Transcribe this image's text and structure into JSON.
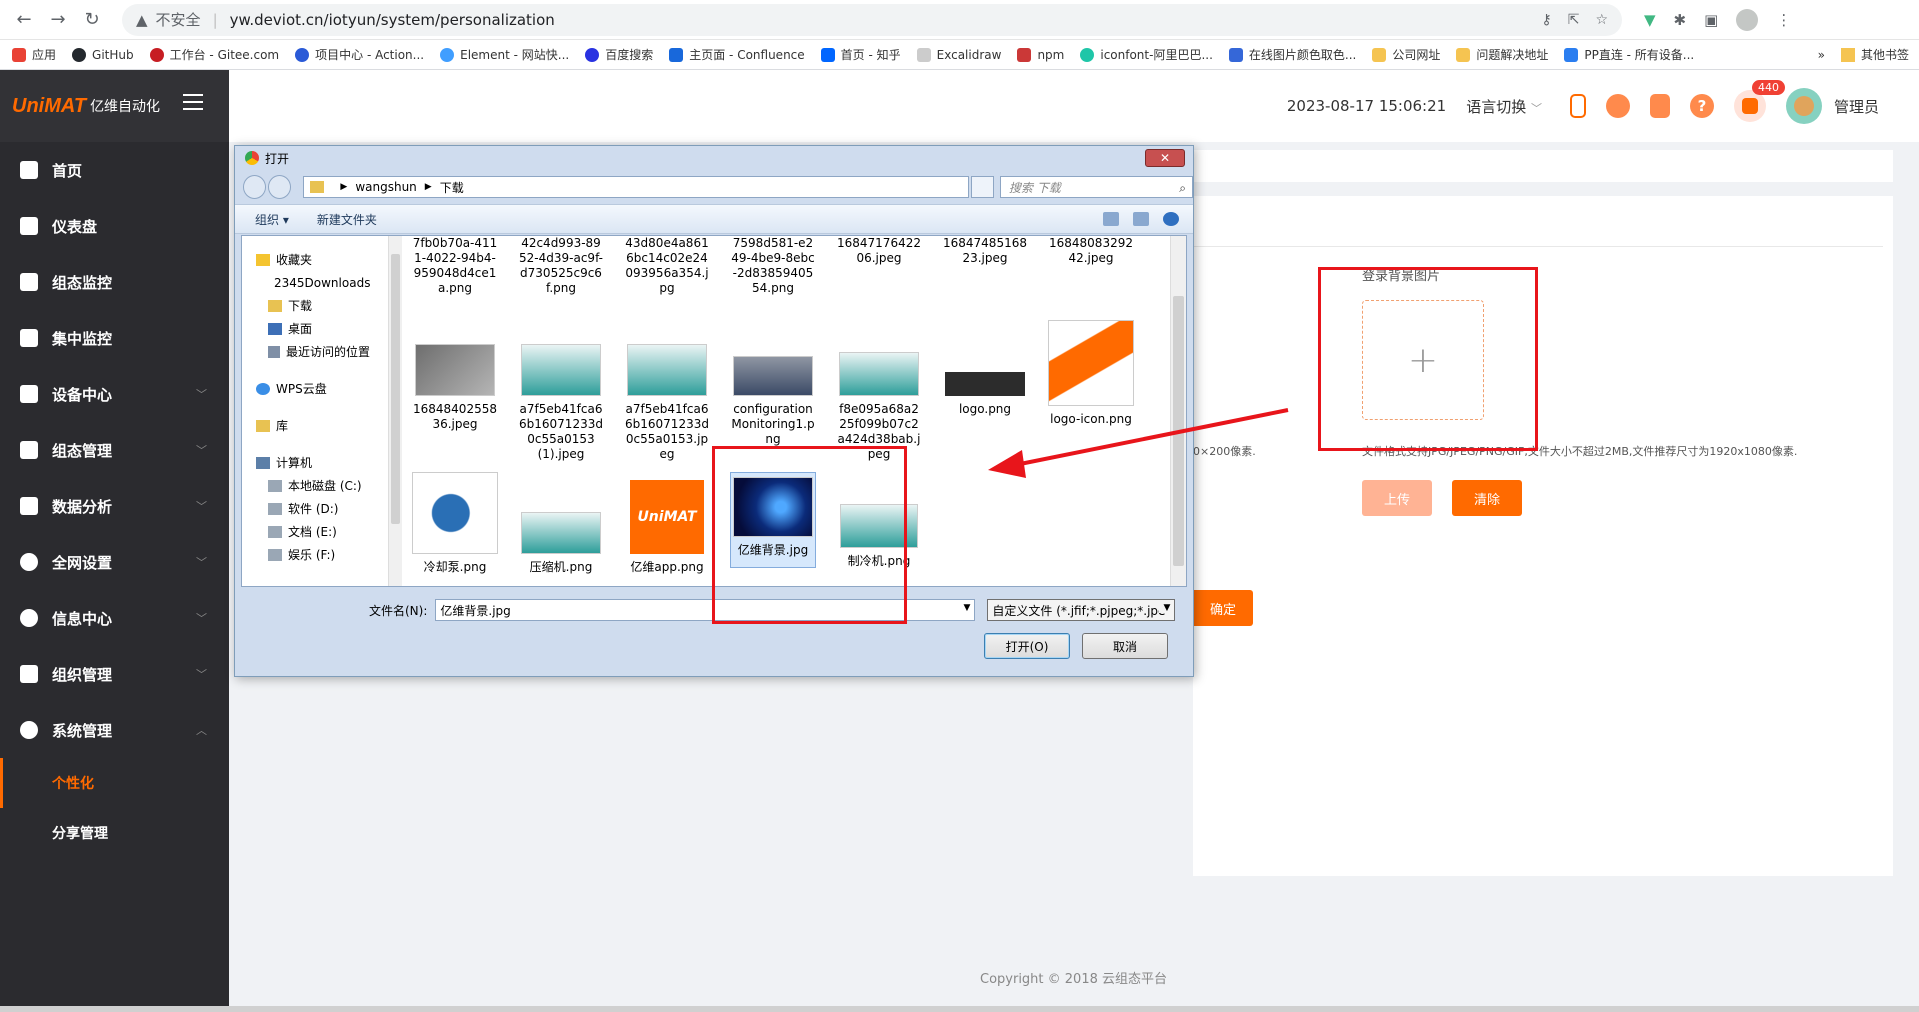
{
  "browser": {
    "insecure_label": "不安全",
    "url": "yw.deviot.cn/iotyun/system/personalization",
    "bookmarks": [
      "应用",
      "GitHub",
      "工作台 - Gitee.com",
      "项目中心 - Action...",
      "Element - 网站快...",
      "百度搜索",
      "主页面 - Confluence",
      "首页 - 知乎",
      "Excalidraw",
      "npm",
      "iconfont-阿里巴巴...",
      "在线图片颜色取色...",
      "公司网址",
      "问题解决地址",
      "PP直连 - 所有设备..."
    ],
    "bookmarks_more": "»",
    "other_bookmarks": "其他书签"
  },
  "sidebar": {
    "logo_text": "UniMAT",
    "logo_cn": "亿维自动化",
    "items": [
      {
        "label": "首页"
      },
      {
        "label": "仪表盘"
      },
      {
        "label": "组态监控"
      },
      {
        "label": "集中监控"
      },
      {
        "label": "设备中心"
      },
      {
        "label": "组态管理"
      },
      {
        "label": "数据分析"
      },
      {
        "label": "全网设置"
      },
      {
        "label": "信息中心"
      },
      {
        "label": "组织管理"
      },
      {
        "label": "系统管理"
      }
    ],
    "sub_items": [
      {
        "label": "个性化"
      },
      {
        "label": "分享管理"
      }
    ]
  },
  "header": {
    "datetime": "2023-08-17 15:06:21",
    "language": "语言切换",
    "badge_count": "440",
    "user": "管理员"
  },
  "main": {
    "login_bg_label": "登录背景图片",
    "upload_plus": "+",
    "hint_left": "0×200像素.",
    "hint_right": "文件格式支持JPG/JPEG/PNG/GIF,文件大小不超过2MB,文件推荐尺寸为1920x1080像素.",
    "upload_btn": "上传",
    "clear_btn": "清除",
    "confirm_btn": "确定",
    "copyright": "Copyright © 2018 云组态平台"
  },
  "dialog": {
    "title": "打开",
    "close": "✕",
    "path": [
      "wangshun",
      "下载"
    ],
    "search_placeholder": "搜索 下载",
    "toolbar": {
      "organize": "组织 ▾",
      "new_folder": "新建文件夹"
    },
    "tree": [
      {
        "label": "收藏夹"
      },
      {
        "label": "2345Downloads"
      },
      {
        "label": "下载"
      },
      {
        "label": "桌面"
      },
      {
        "label": "最近访问的位置"
      },
      {
        "label": "WPS云盘"
      },
      {
        "label": "库"
      },
      {
        "label": "计算机"
      },
      {
        "label": "本地磁盘 (C:)"
      },
      {
        "label": "软件 (D:)"
      },
      {
        "label": "文档 (E:)"
      },
      {
        "label": "娱乐 (F:)"
      }
    ],
    "files": [
      {
        "name": "7fb0b70a-4111-4022-94b4-959048d4ce1a.png"
      },
      {
        "name": "42c4d993-8952-4d39-ac9f-d730525c9c6f.png"
      },
      {
        "name": "43d80e4a8616bc14c02e24093956a354.jpg"
      },
      {
        "name": "7598d581-e249-4be9-8ebc-2d8385940554.png"
      },
      {
        "name": "1684717642206.jpeg"
      },
      {
        "name": "1684748516823.jpeg"
      },
      {
        "name": "1684808329242.jpeg"
      },
      {
        "name": "1684840255836.jpeg"
      },
      {
        "name": "a7f5eb41fca66b16071233d0c55a0153 (1).jpeg"
      },
      {
        "name": "a7f5eb41fca66b16071233d0c55a0153.jpeg"
      },
      {
        "name": "configurationMonitoring1.png"
      },
      {
        "name": "f8e095a68a225f099b07c2a424d38bab.jpeg"
      },
      {
        "name": "logo.png"
      },
      {
        "name": "logo-icon.png"
      },
      {
        "name": "冷却泵.png"
      },
      {
        "name": "压缩机.png"
      },
      {
        "name": "亿维app.png"
      },
      {
        "name": "亿维背景.jpg"
      },
      {
        "name": "制冷机.png"
      }
    ],
    "filename_label": "文件名(N):",
    "filename_value": "亿维背景.jpg",
    "filter_value": "自定义文件 (*.jfif;*.pjpeg;*.jpe",
    "open_btn": "打开(O)",
    "cancel_btn": "取消"
  },
  "colors": {
    "accent": "#ff6a00",
    "sidebar_bg": "#2b2b2f",
    "annotation_red": "#e8151b"
  }
}
